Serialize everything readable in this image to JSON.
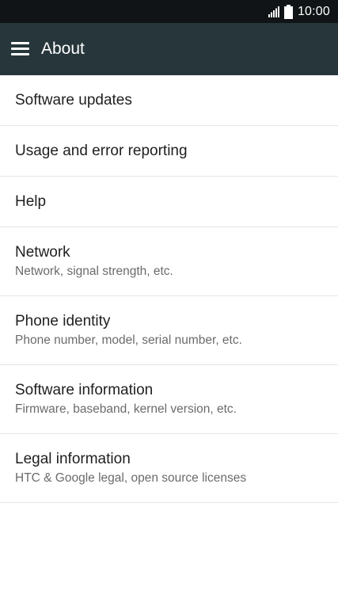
{
  "status_bar": {
    "time": "10:00",
    "icons": [
      "signal-icon",
      "battery-icon"
    ]
  },
  "app_bar": {
    "title": "About",
    "menu_icon": "hamburger-menu-icon",
    "background_color": "#26363b"
  },
  "items": [
    {
      "title": "Software updates"
    },
    {
      "title": "Usage and error reporting"
    },
    {
      "title": "Help"
    },
    {
      "title": "Network",
      "subtitle": "Network, signal strength, etc."
    },
    {
      "title": "Phone identity",
      "subtitle": "Phone number, model, serial number, etc."
    },
    {
      "title": "Software information",
      "subtitle": "Firmware, baseband, kernel version, etc."
    },
    {
      "title": "Legal information",
      "subtitle": "HTC & Google legal, open source licenses"
    }
  ]
}
